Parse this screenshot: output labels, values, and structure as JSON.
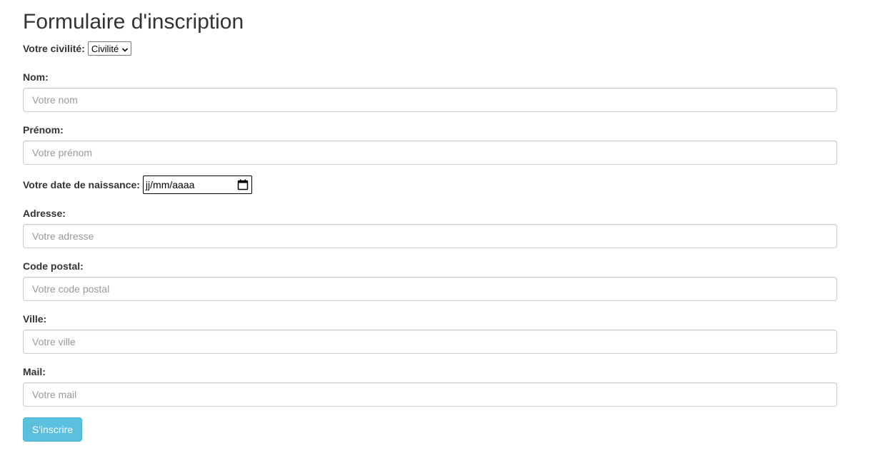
{
  "form": {
    "title": "Formulaire d'inscription",
    "civility": {
      "label": "Votre civilité:",
      "selected": "Civilité"
    },
    "fields": {
      "nom": {
        "label": "Nom:",
        "placeholder": "Votre nom",
        "value": ""
      },
      "prenom": {
        "label": "Prénom:",
        "placeholder": "Votre prénom",
        "value": ""
      },
      "birthdate": {
        "label": "Votre date de naissance:",
        "placeholder": "jj/mm/aaaa"
      },
      "adresse": {
        "label": "Adresse:",
        "placeholder": "Votre adresse",
        "value": ""
      },
      "code_postal": {
        "label": "Code postal:",
        "placeholder": "Votre code postal",
        "value": ""
      },
      "ville": {
        "label": "Ville:",
        "placeholder": "Votre ville",
        "value": ""
      },
      "mail": {
        "label": "Mail:",
        "placeholder": "Votre mail",
        "value": ""
      }
    },
    "submit_label": "S'inscrire",
    "submit_color": "#5bc0de"
  },
  "icons": {
    "select_chevron": "chevron-down-icon",
    "date_picker": "calendar-icon"
  }
}
